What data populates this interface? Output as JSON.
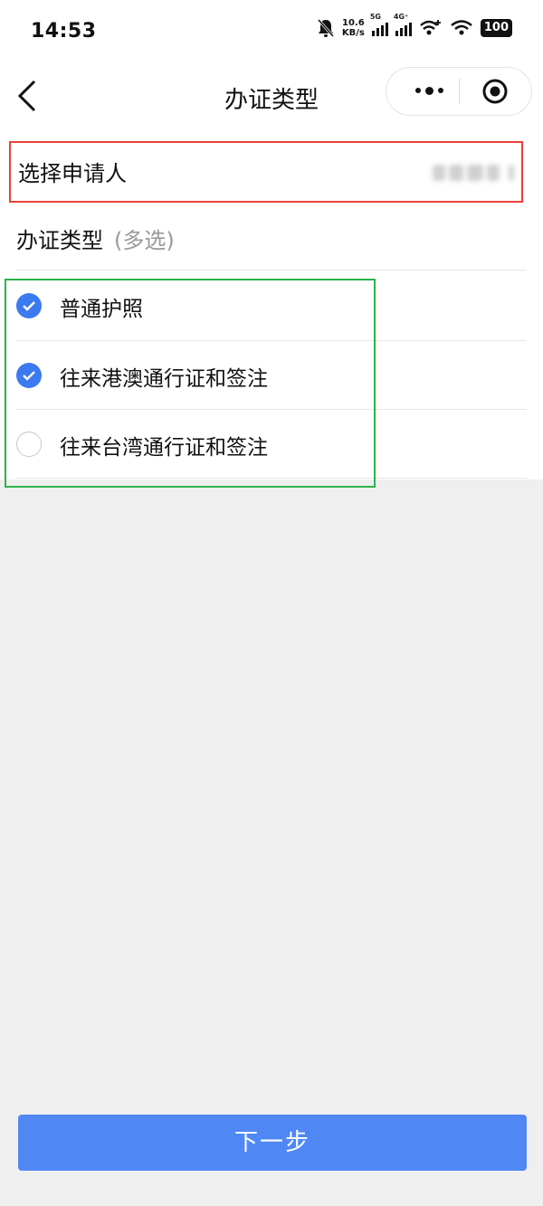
{
  "status_bar": {
    "time": "14:53",
    "net_speed": "10.6",
    "net_unit": "KB/s",
    "signal_1": "5G",
    "signal_2": "4G⁺",
    "battery": "100"
  },
  "header": {
    "title": "办证类型",
    "back_icon": "chevron-left-icon",
    "more_icon": "more-dots-icon",
    "close_icon": "record-target-icon"
  },
  "applicant": {
    "label": "选择申请人"
  },
  "cert_type": {
    "label": "办证类型",
    "hint": "(多选)"
  },
  "options": [
    {
      "label": "普通护照",
      "checked": true
    },
    {
      "label": "往来港澳通行证和签注",
      "checked": true
    },
    {
      "label": "往来台湾通行证和签注",
      "checked": false
    }
  ],
  "footer": {
    "next_label": "下一步"
  },
  "colors": {
    "accent": "#3b7af0",
    "button": "#4f87f5",
    "highlight_red": "#e8413b",
    "highlight_green": "#2db34a"
  }
}
